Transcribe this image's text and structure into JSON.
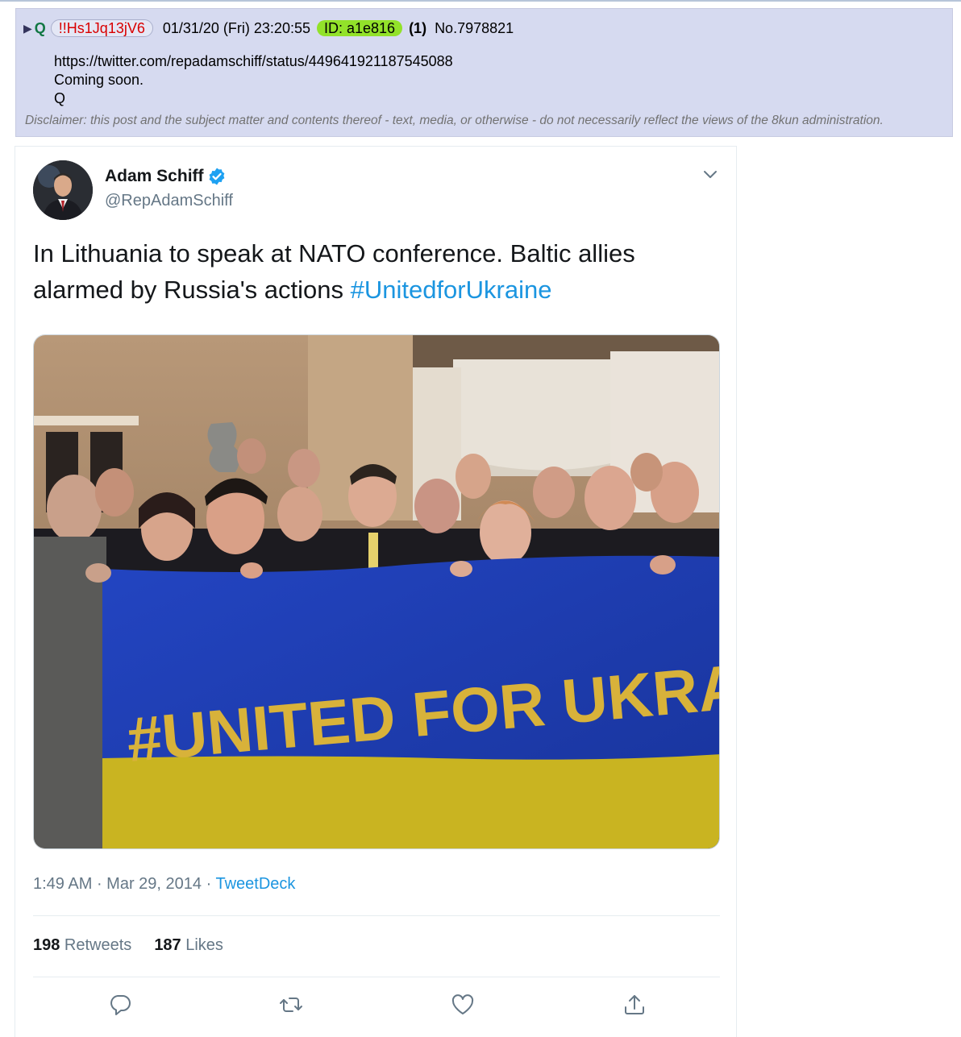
{
  "post": {
    "arrow": "▶",
    "name": "Q",
    "tripcode": "!!Hs1Jq13jV6",
    "datetime": "01/31/20 (Fri) 23:20:55",
    "id_label": "ID: a1e816",
    "reply_count": "(1)",
    "post_number": "No.7978821",
    "lines": [
      "https://twitter.com/repadamschiff/status/449641921187545088",
      "Coming soon.",
      "Q"
    ],
    "disclaimer": "Disclaimer: this post and the subject matter and contents thereof - text, media, or otherwise - do not necessarily reflect the views of the 8kun administration."
  },
  "tweet": {
    "author_name": "Adam Schiff",
    "handle": "@RepAdamSchiff",
    "text": "In Lithuania to speak at NATO conference. Baltic allies alarmed by Russia's actions ",
    "hashtag": "#UnitedforUkraine",
    "photo_banner_text": "#UNITED FOR UKRAINE",
    "time": "1:49 AM",
    "separator": " · ",
    "date": "Mar 29, 2014",
    "source": "TweetDeck",
    "retweets_count": "198",
    "retweets_label": " Retweets",
    "likes_count": "187",
    "likes_label": " Likes",
    "colors": {
      "link": "#1b95e0",
      "verified": "#1da1f2",
      "banner_blue": "#1d3fb0",
      "banner_yellow": "#c9b421"
    }
  }
}
